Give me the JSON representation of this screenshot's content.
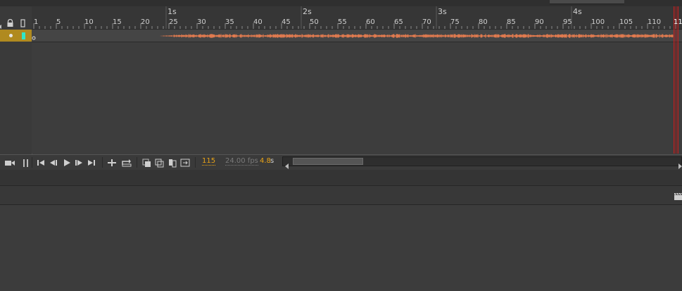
{
  "ruler": {
    "frame_labels": [
      "1",
      "5",
      "10",
      "15",
      "20",
      "25",
      "30",
      "35",
      "40",
      "45",
      "50",
      "55",
      "60",
      "65",
      "70",
      "75",
      "80",
      "85",
      "90",
      "95",
      "100",
      "105",
      "110",
      "11"
    ],
    "second_labels": [
      "1s",
      "2s",
      "3s",
      "4s"
    ]
  },
  "icons": {
    "lock": "lock-icon",
    "outline": "outline-icon",
    "camera": "camera-icon",
    "clapper": "clapperboard-icon"
  },
  "controls": {
    "current_frame": "115",
    "fps": "24.00 fps",
    "elapsed_time": "4.8",
    "time_unit": "s"
  },
  "colors": {
    "layer_highlight": "#b08a1f",
    "layer_swatch": "#2fe6c8",
    "waveform": "#e07a4f",
    "playhead": "#c02020",
    "readout_accent": "#e8a317"
  }
}
